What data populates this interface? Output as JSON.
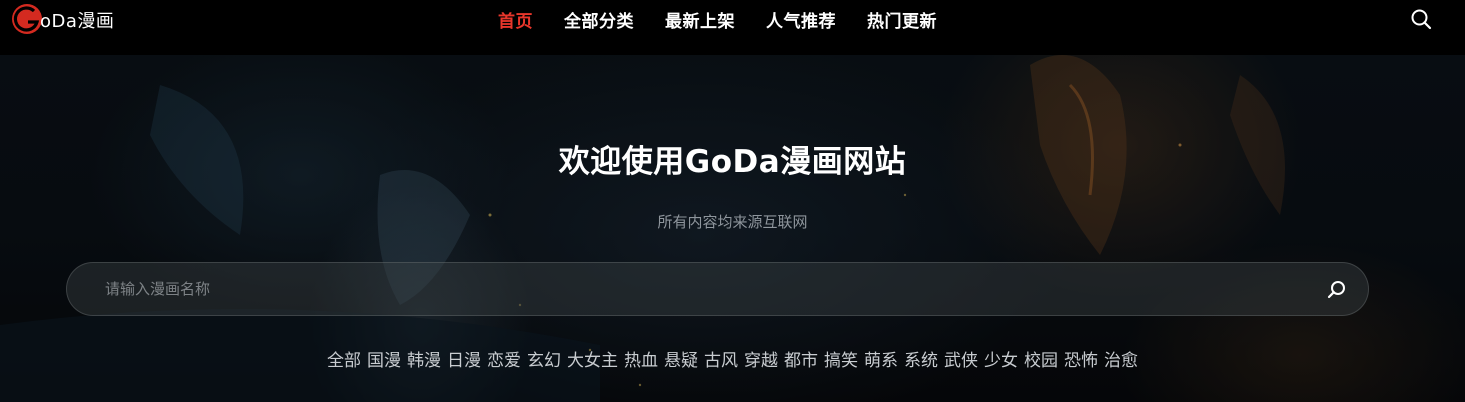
{
  "header": {
    "logo_text": "oDa漫画",
    "nav": [
      {
        "label": "首页",
        "active": true
      },
      {
        "label": "全部分类",
        "active": false
      },
      {
        "label": "最新上架",
        "active": false
      },
      {
        "label": "人气推荐",
        "active": false
      },
      {
        "label": "热门更新",
        "active": false
      }
    ],
    "search_icon": "search-icon"
  },
  "hero": {
    "title": "欢迎使用GoDa漫画网站",
    "subtitle": "所有内容均来源互联网",
    "search": {
      "placeholder": "请输入漫画名称",
      "value": "",
      "icon": "search-icon"
    },
    "tags": [
      "全部",
      "国漫",
      "韩漫",
      "日漫",
      "恋爱",
      "玄幻",
      "大女主",
      "热血",
      "悬疑",
      "古风",
      "穿越",
      "都市",
      "搞笑",
      "萌系",
      "系统",
      "武侠",
      "少女",
      "校园",
      "恐怖",
      "治愈"
    ]
  },
  "colors": {
    "accent": "#e8362b",
    "background": "#000000",
    "text": "#ffffff"
  }
}
